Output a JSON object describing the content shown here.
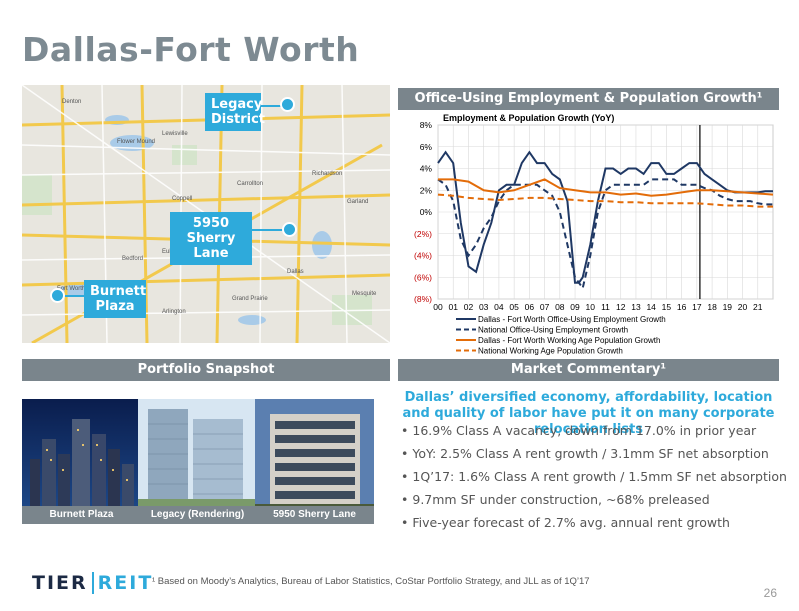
{
  "title": "Dallas-Fort Worth",
  "map": {
    "labels": [
      {
        "text": "Legacy\nDistrict",
        "name": "legacy-district"
      },
      {
        "text": "5950 Sherry\nLane",
        "name": "sherry-lane"
      },
      {
        "text": "Burnett\nPlaza",
        "name": "burnett-plaza"
      }
    ],
    "place_names": [
      "Flower Mound",
      "Lewisville",
      "Carrollton",
      "Richardson",
      "Garland",
      "Coppell",
      "Irving",
      "Dallas",
      "Fort Worth",
      "Arlington",
      "Grand Prairie",
      "Bedford",
      "Euless",
      "Mesquite",
      "Denton"
    ]
  },
  "headers": {
    "chart": "Office-Using Employment & Population Growth¹",
    "portfolio": "Portfolio Snapshot",
    "commentary": "Market Commentary¹"
  },
  "photos": [
    {
      "caption": "Burnett Plaza"
    },
    {
      "caption": "Legacy (Rendering)"
    },
    {
      "caption": "5950 Sherry Lane"
    }
  ],
  "commentary": {
    "headline": "Dallas’ diversified economy, affordability, location and quality of labor have put it on many corporate relocation lists",
    "bullets": [
      "16.9% Class A vacancy, down from 17.0% in prior year",
      "YoY: 2.5% Class A rent growth / 3.1mm SF net absorption",
      "1Q’17: 1.6% Class A rent growth / 1.5mm SF net absorption",
      "9.7mm SF under construction, ~68% preleased",
      "Five-year forecast of 2.7% avg. annual rent growth"
    ]
  },
  "footer": {
    "logo_left": "TIER",
    "logo_right": "REIT",
    "footnote": "¹ Based on Moody’s Analytics, Bureau of Labor Statistics, CoStar Portfolio Strategy, and JLL as of 1Q’17",
    "page": "26"
  },
  "chart_data": {
    "type": "line",
    "title": "Employment & Population Growth (YoY)",
    "x_tick_labels": [
      "00",
      "01",
      "02",
      "03",
      "04",
      "05",
      "06",
      "07",
      "08",
      "09",
      "10",
      "11",
      "12",
      "13",
      "14",
      "15",
      "16",
      "17",
      "18",
      "19",
      "20",
      "21"
    ],
    "xlim": [
      2000,
      2022
    ],
    "ylim": [
      -8,
      8
    ],
    "y_ticks": [
      8,
      6,
      4,
      2,
      0,
      -2,
      -4,
      -6,
      -8
    ],
    "y_tick_labels": [
      "8%",
      "6%",
      "4%",
      "2%",
      "0%",
      "(2%)",
      "(4%)",
      "(6%)",
      "(8%)"
    ],
    "vertical_marker": 2017.2,
    "colors": {
      "dfw_emp": "#1f3864",
      "nat_emp": "#1f3864",
      "dfw_pop": "#e36c09",
      "nat_pop": "#e36c09",
      "neg_tick": "#c00000"
    },
    "series": [
      {
        "name": "Dallas - Fort Worth Office-Using Employment Growth",
        "style": "solid",
        "color": "#1f3864",
        "x": [
          2000,
          2000.5,
          2001,
          2001.5,
          2002,
          2002.5,
          2003,
          2003.5,
          2004,
          2004.5,
          2005,
          2005.5,
          2006,
          2006.5,
          2007,
          2007.5,
          2008,
          2008.5,
          2009,
          2009.25,
          2009.5,
          2010,
          2010.5,
          2011,
          2011.5,
          2012,
          2012.5,
          2013,
          2013.5,
          2014,
          2014.5,
          2015,
          2015.5,
          2016,
          2016.5,
          2017,
          2017.5,
          2018,
          2018.5,
          2019,
          2019.5,
          2020,
          2020.5,
          2021,
          2021.5,
          2022
        ],
        "y": [
          4.5,
          5.5,
          4.5,
          -1,
          -5,
          -5.5,
          -3,
          -1,
          2,
          2.5,
          2.5,
          4.5,
          5.5,
          4.5,
          4.5,
          3.5,
          3,
          1,
          -6.5,
          -6.5,
          -6,
          -3,
          1,
          4,
          4,
          3.5,
          4,
          4,
          3.5,
          4.5,
          4.5,
          3.5,
          3.5,
          4,
          4.5,
          4.5,
          3.5,
          3,
          2.5,
          2,
          1.8,
          1.8,
          1.8,
          1.8,
          1.9,
          1.9
        ]
      },
      {
        "name": "National Office-Using Employment Growth",
        "style": "dashed",
        "color": "#1f3864",
        "x": [
          2000,
          2000.5,
          2001,
          2001.5,
          2002,
          2002.5,
          2003,
          2003.5,
          2004,
          2004.5,
          2005,
          2005.5,
          2006,
          2006.5,
          2007,
          2007.5,
          2008,
          2008.5,
          2009,
          2009.5,
          2010,
          2010.5,
          2011,
          2011.5,
          2012,
          2012.5,
          2013,
          2013.5,
          2014,
          2014.5,
          2015,
          2015.5,
          2016,
          2016.5,
          2017,
          2017.5,
          2018,
          2018.5,
          2019,
          2019.5,
          2020,
          2020.5,
          2021,
          2021.5,
          2022
        ],
        "y": [
          3,
          2.5,
          1,
          -2.5,
          -4,
          -3,
          -1.5,
          -0.5,
          1,
          2,
          2.5,
          2.5,
          2.5,
          2.5,
          2,
          1.5,
          0,
          -3,
          -6,
          -7,
          -4,
          0,
          2,
          2.5,
          2.5,
          2.5,
          2.5,
          2.5,
          3,
          3,
          3,
          3,
          2.5,
          2.5,
          2.5,
          2.2,
          2,
          1.5,
          1.2,
          1,
          1,
          1,
          0.8,
          0.7,
          0.7
        ]
      },
      {
        "name": "Dallas - Fort Worth Working Age Population Growth",
        "style": "solid",
        "color": "#e36c09",
        "x": [
          2000,
          2001,
          2002,
          2003,
          2004,
          2005,
          2006,
          2007,
          2008,
          2009,
          2010,
          2011,
          2012,
          2013,
          2014,
          2015,
          2016,
          2017,
          2018,
          2019,
          2020,
          2021,
          2022
        ],
        "y": [
          3,
          3,
          2.8,
          2,
          1.8,
          2,
          2.5,
          3,
          2.2,
          2,
          1.8,
          1.8,
          1.6,
          1.7,
          1.5,
          1.6,
          1.8,
          2,
          2,
          1.9,
          1.8,
          1.7,
          1.6
        ]
      },
      {
        "name": "National Working Age Population Growth",
        "style": "dashed",
        "color": "#e36c09",
        "x": [
          2000,
          2001,
          2002,
          2003,
          2004,
          2005,
          2006,
          2007,
          2008,
          2009,
          2010,
          2011,
          2012,
          2013,
          2014,
          2015,
          2016,
          2017,
          2018,
          2019,
          2020,
          2021,
          2022
        ],
        "y": [
          1.6,
          1.5,
          1.3,
          1.2,
          1.1,
          1.2,
          1.3,
          1.3,
          1.2,
          1.1,
          1,
          1,
          0.9,
          0.9,
          0.8,
          0.8,
          0.8,
          0.8,
          0.7,
          0.6,
          0.6,
          0.5,
          0.5
        ]
      }
    ],
    "legend_position": "bottom"
  }
}
